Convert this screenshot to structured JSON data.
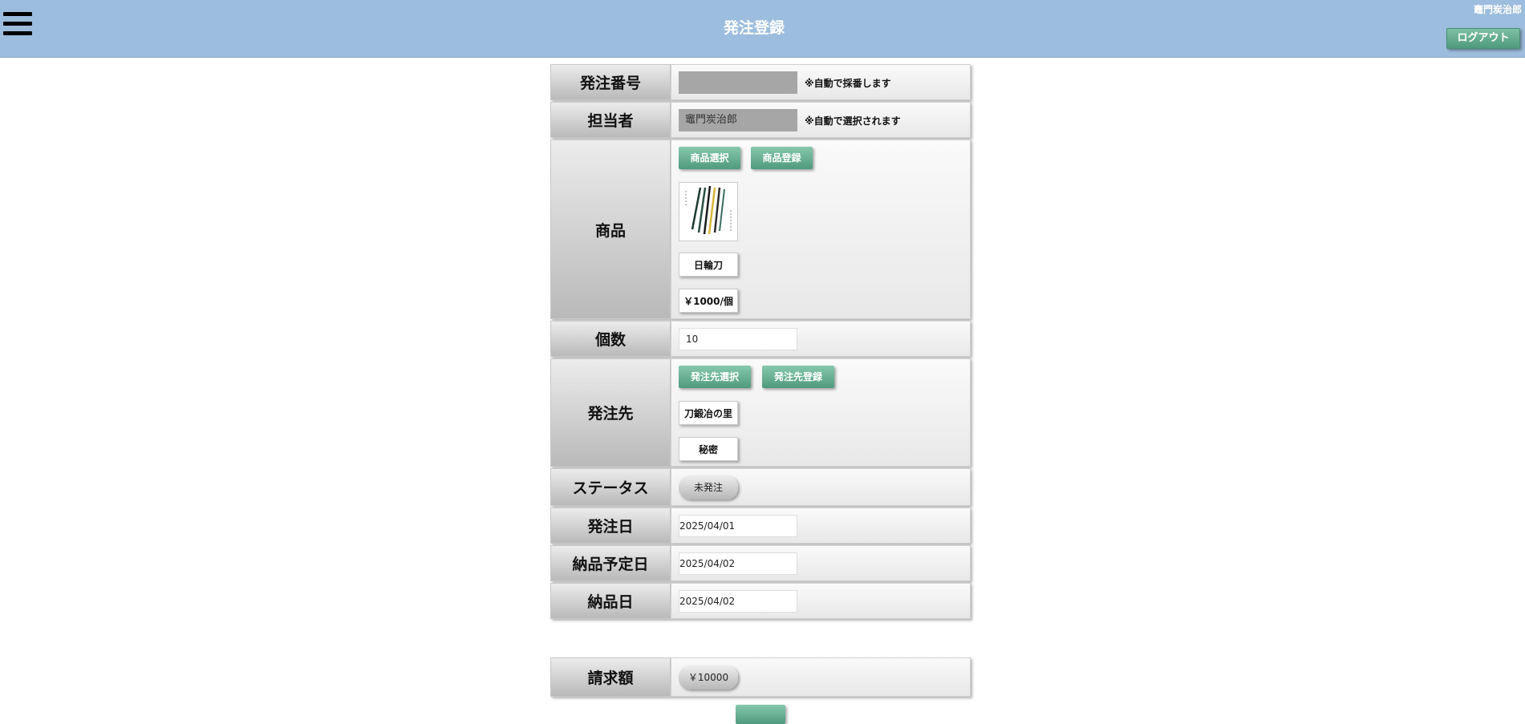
{
  "header": {
    "title": "発注登録",
    "user_name": "竈門炭治郎",
    "logout_label": "ログアウト"
  },
  "form": {
    "order_number": {
      "label": "発注番号",
      "value": "",
      "note": "※自動で採番します"
    },
    "staff": {
      "label": "担当者",
      "value": "竈門炭治郎",
      "note": "※自動で選択されます"
    },
    "product": {
      "label": "商品",
      "select_button": "商品選択",
      "register_button": "商品登録",
      "name": "日輪刀",
      "price": "￥1000/個"
    },
    "quantity": {
      "label": "個数",
      "value": "10"
    },
    "supplier": {
      "label": "発注先",
      "select_button": "発注先選択",
      "register_button": "発注先登録",
      "name": "刀鍛冶の里",
      "address": "秘密"
    },
    "status": {
      "label": "ステータス",
      "value": "未発注"
    },
    "order_date": {
      "label": "発注日",
      "value": "2025/04/01"
    },
    "expected_delivery_date": {
      "label": "納品予定日",
      "value": "2025/04/02"
    },
    "delivery_date": {
      "label": "納品日",
      "value": "2025/04/02"
    },
    "invoice_amount": {
      "label": "請求額",
      "value": "￥10000"
    }
  },
  "colors": {
    "header_bg": "#9dbddf",
    "accent_green": "#5fa98b"
  },
  "icons": {
    "menu": "hamburger-menu-icon"
  }
}
